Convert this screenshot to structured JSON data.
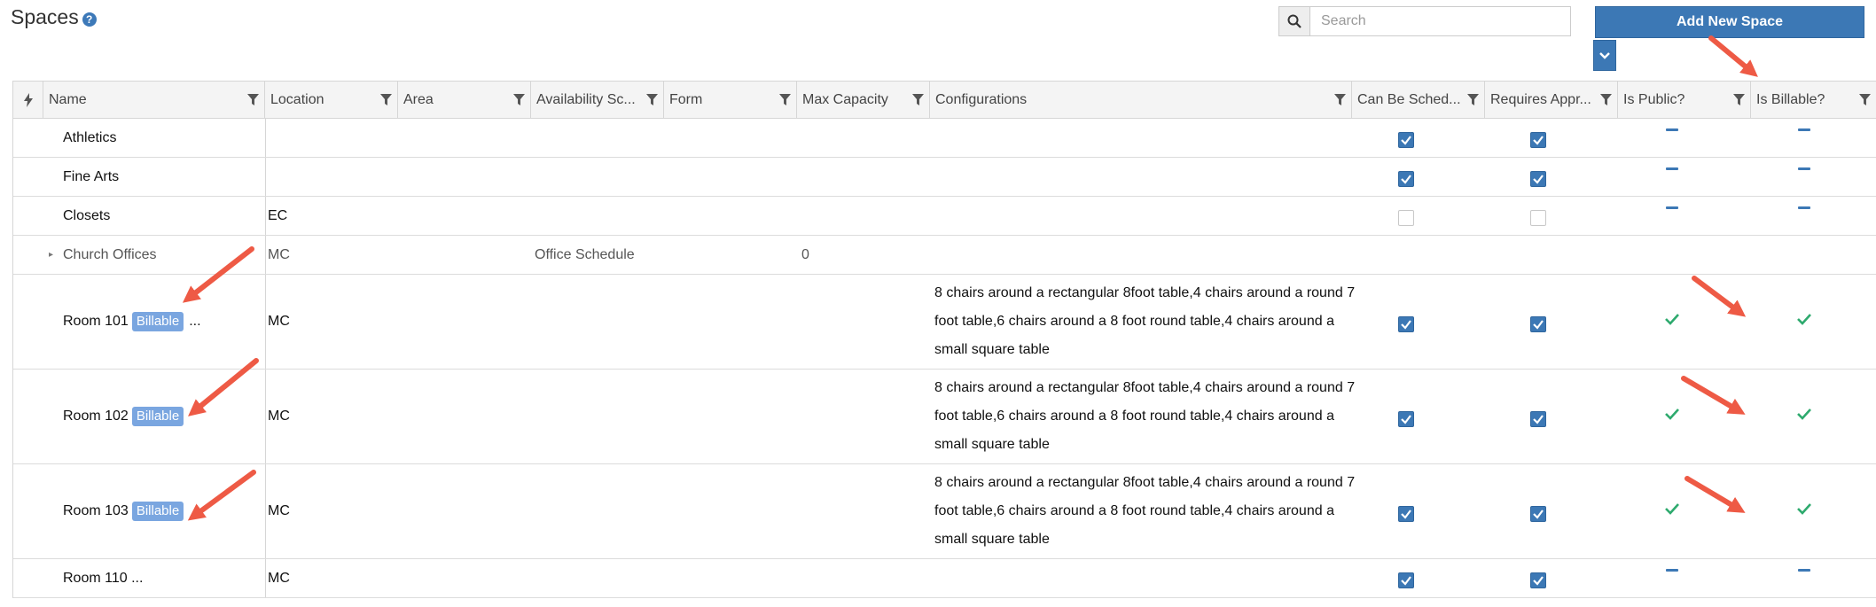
{
  "header": {
    "title": "Spaces",
    "help_icon": "question-circle-icon"
  },
  "search": {
    "placeholder": "Search",
    "value": ""
  },
  "actions": {
    "add_label": "Add New Space"
  },
  "columns": [
    {
      "key": "bulk",
      "label": ""
    },
    {
      "key": "name",
      "label": "Name"
    },
    {
      "key": "location",
      "label": "Location"
    },
    {
      "key": "area",
      "label": "Area"
    },
    {
      "key": "availability",
      "label": "Availability Sc..."
    },
    {
      "key": "form",
      "label": "Form"
    },
    {
      "key": "max_capacity",
      "label": "Max Capacity"
    },
    {
      "key": "configurations",
      "label": "Configurations"
    },
    {
      "key": "can_be_scheduled",
      "label": "Can Be Sched..."
    },
    {
      "key": "requires_approval",
      "label": "Requires Appr..."
    },
    {
      "key": "is_public",
      "label": "Is Public?"
    },
    {
      "key": "is_billable",
      "label": "Is Billable?"
    }
  ],
  "rows": [
    {
      "name": "Athletics",
      "location": "",
      "availability": "",
      "max_capacity": "",
      "configurations": "",
      "can_be_scheduled": "checked",
      "requires_approval": "checked",
      "is_public": "dash",
      "is_billable": "dash"
    },
    {
      "name": "Fine Arts",
      "location": "",
      "availability": "",
      "max_capacity": "",
      "configurations": "",
      "can_be_scheduled": "checked",
      "requires_approval": "checked",
      "is_public": "dash",
      "is_billable": "dash"
    },
    {
      "name": "Closets",
      "location": "EC",
      "availability": "",
      "max_capacity": "",
      "configurations": "",
      "can_be_scheduled": "unchecked",
      "requires_approval": "unchecked",
      "is_public": "dash",
      "is_billable": "dash"
    },
    {
      "name": "Church Offices",
      "location": "MC",
      "availability": "Office Schedule",
      "max_capacity": "0",
      "configurations": "",
      "can_be_scheduled": "none",
      "requires_approval": "none",
      "is_public": "none",
      "is_billable": "none"
    },
    {
      "name": "Room 101",
      "badge": "Billable",
      "trailing": "...",
      "location": "MC",
      "availability": "",
      "max_capacity": "",
      "configurations": "8 chairs around a rectangular 8foot table,4 chairs around a round 7 foot table,6 chairs around a 8 foot round table,4 chairs around a small square table",
      "can_be_scheduled": "checked",
      "requires_approval": "checked",
      "is_public": "check",
      "is_billable": "check"
    },
    {
      "name": "Room 102",
      "badge": "Billable",
      "trailing": "",
      "location": "MC",
      "availability": "",
      "max_capacity": "",
      "configurations": "8 chairs around a rectangular 8foot table,4 chairs around a round 7 foot table,6 chairs around a 8 foot round table,4 chairs around a small square table",
      "can_be_scheduled": "checked",
      "requires_approval": "checked",
      "is_public": "check",
      "is_billable": "check"
    },
    {
      "name": "Room 103",
      "badge": "Billable",
      "trailing": "",
      "location": "MC",
      "availability": "",
      "max_capacity": "",
      "configurations": "8 chairs around a rectangular 8foot table,4 chairs around a round 7 foot table,6 chairs around a 8 foot round table,4 chairs around a small square table",
      "can_be_scheduled": "checked",
      "requires_approval": "checked",
      "is_public": "check",
      "is_billable": "check"
    },
    {
      "name": "Room 110 ...",
      "location": "MC",
      "availability": "",
      "max_capacity": "",
      "configurations": "",
      "can_be_scheduled": "checked",
      "requires_approval": "checked",
      "is_public": "dash",
      "is_billable": "dash"
    }
  ],
  "colors": {
    "primary": "#3c78b5",
    "badge": "#7aa6e0",
    "check_green": "#2eaa6e",
    "arrow": "#ee5a45"
  }
}
